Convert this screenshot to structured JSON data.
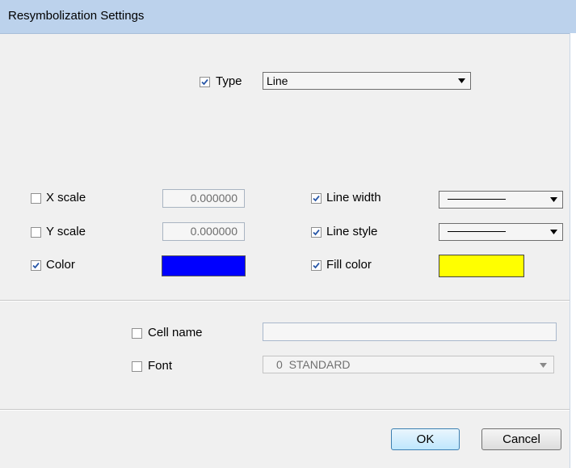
{
  "window": {
    "title": "Resymbolization Settings"
  },
  "type_row": {
    "label": "Type",
    "checked": true,
    "value": "Line"
  },
  "left": {
    "x_scale": {
      "label": "X scale",
      "checked": false,
      "value": "0.000000"
    },
    "y_scale": {
      "label": "Y scale",
      "checked": false,
      "value": "0.000000"
    },
    "color": {
      "label": "Color",
      "checked": true,
      "swatch": "#0000ff"
    }
  },
  "right": {
    "line_width": {
      "label": "Line width",
      "checked": true
    },
    "line_style": {
      "label": "Line style",
      "checked": true
    },
    "fill_color": {
      "label": "Fill color",
      "checked": true,
      "swatch": "#ffff00"
    }
  },
  "lower": {
    "cell_name": {
      "label": "Cell name",
      "checked": false,
      "value": ""
    },
    "font": {
      "label": "Font",
      "checked": false,
      "value": "0  STANDARD"
    }
  },
  "buttons": {
    "ok": "OK",
    "cancel": "Cancel"
  },
  "icons": {
    "checkbox_check": "checkmark-icon",
    "dropdown_arrow": "triangle-down-icon"
  }
}
